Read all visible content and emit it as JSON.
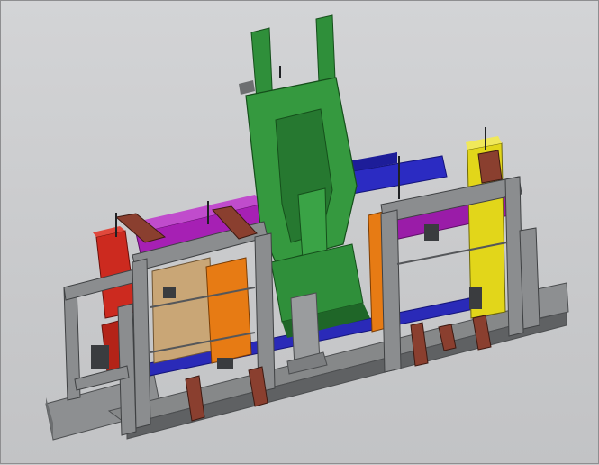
{
  "scene": {
    "kind": "cad-3d-model-view",
    "colors": {
      "background": "#c9cacc",
      "frame": "#8a8c8e",
      "frame_dark": "#5d5f61",
      "green_tower": "#2f8f3a",
      "green_dark": "#1f6628",
      "red_block": "#c8281f",
      "magenta_rail": "#a21fb0",
      "blue_rail": "#2322b8",
      "orange_plate": "#e67a14",
      "yellow_part": "#e3d81c",
      "clamp_brown": "#8a3f2f",
      "tan_part": "#c7a06a"
    }
  }
}
